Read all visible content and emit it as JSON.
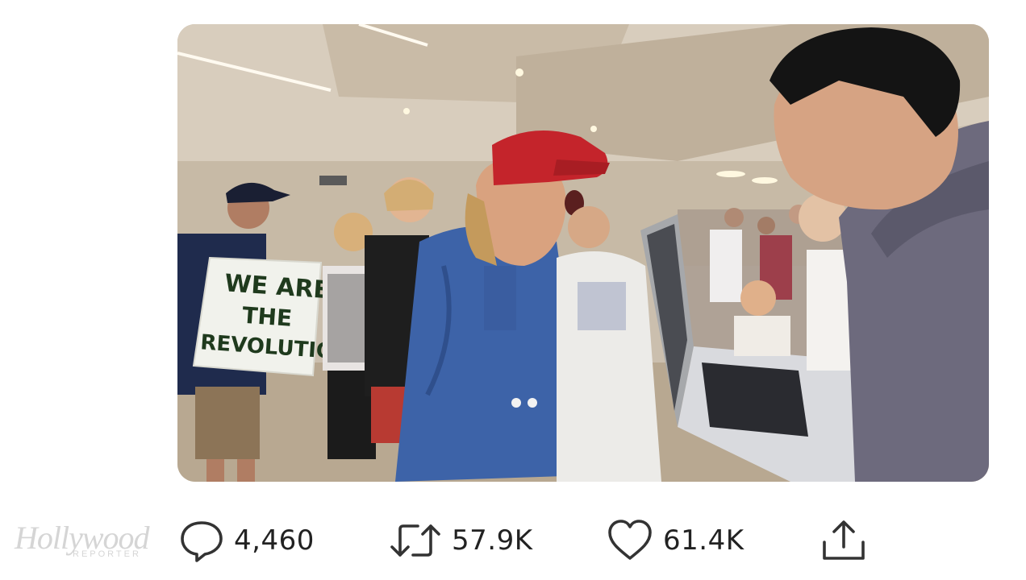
{
  "tweet": {
    "media": {
      "sign_lines": [
        "WE ARE",
        "THE",
        "REVOLUTION"
      ]
    },
    "actions": {
      "reply": {
        "icon": "reply-bubble-icon",
        "count": "4,460"
      },
      "retweet": {
        "icon": "retweet-arrows-icon",
        "count": "57.9K"
      },
      "like": {
        "icon": "heart-icon",
        "count": "61.4K"
      },
      "share": {
        "icon": "share-upload-icon"
      }
    }
  },
  "watermark": {
    "main": "Hollywood",
    "sub": "REPORTER"
  },
  "colors": {
    "icon_stroke": "#333333",
    "count_text": "#222222",
    "background": "#ffffff"
  }
}
